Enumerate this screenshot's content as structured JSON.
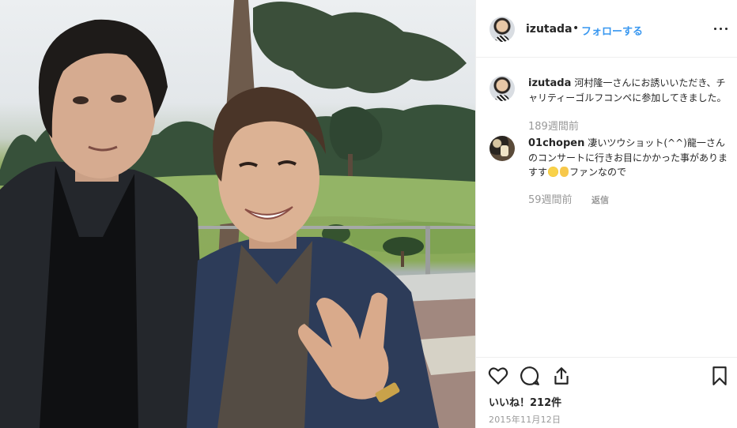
{
  "post": {
    "image_alt": "",
    "header": {
      "username": "izutada",
      "separator": "•",
      "follow_label": "フォローする",
      "more_icon": "more-horizontal-icon"
    },
    "caption": {
      "username": "izutada",
      "text": "河村隆一さんにお誘いいただき、チャリティーゴルフコンペに参加してきました。",
      "age": "189週間前"
    },
    "comments": [
      {
        "username": "01chopen",
        "text_before_emoji": "凄いツウショット(^^)龍一さんのコンサートに行きお目にかかった事がありますす",
        "text_after_emoji": "ファンなので",
        "emojis": [
          "smiling-face-emoji",
          "ok-hand-emoji"
        ],
        "age": "59週間前",
        "reply_label": "返信"
      }
    ],
    "actions": {
      "like_icon": "heart-icon",
      "comment_icon": "comment-icon",
      "share_icon": "share-icon",
      "save_icon": "bookmark-icon"
    },
    "likes_text": "いいね！212件",
    "date_text": "2015年11月12日"
  }
}
